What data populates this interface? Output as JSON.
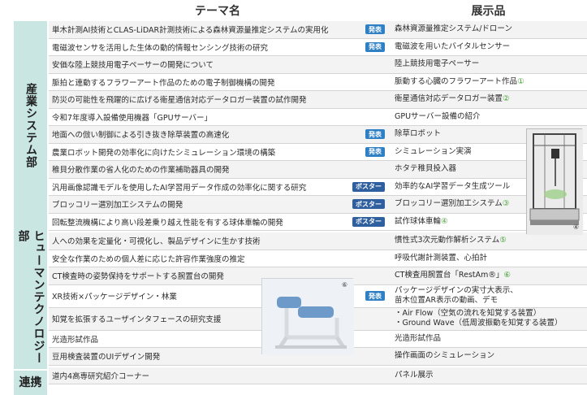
{
  "header": {
    "theme": "テーマ名",
    "exhibit": "展示品"
  },
  "departments": [
    {
      "label": "産業システム部"
    },
    {
      "label": "ヒューマンテクノロジー部"
    },
    {
      "label": "連携"
    }
  ],
  "badges": {
    "present": "発表",
    "poster": "ポスター"
  },
  "rows": [
    {
      "theme": "単木計測AI技術とCLAS-LiDAR計測技術による森林資源量推定システムの実用化",
      "badge": "発表",
      "exhibit": "森林資源量推定システム/ドローン"
    },
    {
      "theme": "電磁波センサを活用した生体の動的情報センシング技術の研究",
      "badge": "発表",
      "exhibit": "電磁波を用いたバイタルセンサー"
    },
    {
      "theme": "安価な陸上競技用電子ペーサーの開発について",
      "exhibit": "陸上競技用電子ペーサー"
    },
    {
      "theme": "脈拍と連動するフラワーアート作品のための電子制御機構の開発",
      "exhibit": "脈動する心臓のフラワーアート作品",
      "exhibit_num": "①"
    },
    {
      "theme": "防災の可能性を飛躍的に広げる衛星通信対応データロガー装置の試作開発",
      "exhibit": "衛星通信対応データロガー装置",
      "exhibit_num": "②"
    },
    {
      "theme": "令和7年度導入設備使用機器「GPUサーバー」",
      "exhibit": "GPUサーバー設備の紹介"
    },
    {
      "theme": "地面への倣い制御による引き抜き除草装置の高速化",
      "badge": "発表",
      "exhibit": "除草ロボット"
    },
    {
      "theme": "農業ロボット開発の効率化に向けたシミュレーション環境の構築",
      "badge": "発表",
      "exhibit": "シミュレーション実演"
    },
    {
      "theme": "稚貝分散作業の省人化のための作業補助器具の開発",
      "exhibit": "ホタテ稚貝投入器"
    },
    {
      "theme": "汎用画像認識モデルを使用したAI学習用データ作成の効率化に関する研究",
      "badge": "ポスター",
      "exhibit": "効率的なAI学習データ生成ツール"
    },
    {
      "theme": "ブロッコリー選別加工システムの開発",
      "badge": "ポスター",
      "exhibit": "ブロッコリー選別加工システム",
      "exhibit_num": "③"
    },
    {
      "theme": "回転整流機構により高い段差乗り越え性能を有する球体車輪の開発",
      "badge": "ポスター",
      "exhibit": "試作球体車輪",
      "exhibit_num": "④"
    },
    {
      "theme": "人への効果を定量化・可視化し、製品デザインに生かす技術",
      "exhibit": "慣性式3次元動作解析システム",
      "exhibit_num": "⑤"
    },
    {
      "theme": "安全な作業のための個人差に応じた許容作業強度の推定",
      "exhibit": "呼吸代謝計測装置、心拍計"
    },
    {
      "theme": "CT検査時の姿勢保持をサポートする腕置台の開発",
      "exhibit": "CT検査用腕置台「RestAm®」",
      "exhibit_num": "⑥"
    },
    {
      "theme": "XR技術×パッケージデザイン・林業",
      "badge": "発表",
      "exhibit": "パッケージデザインの実寸大表示、",
      "exhibit2": "苗木位置AR表示の動画、デモ"
    },
    {
      "theme": "知覚を拡張するユーザインタフェースの研究支援",
      "exhibit": "・Air Flow（空気の流れを知覚する装置）",
      "exhibit2": "・Ground Wave（低周波振動を知覚する装置）"
    },
    {
      "theme": "光造形試作品",
      "exhibit": "光造形試作品"
    },
    {
      "theme": "豆用検査装置のUIデザイン開発",
      "exhibit": "操作画面のシミュレーション"
    },
    {
      "theme": "道内4高専研究紹介コーナー",
      "exhibit": "パネル展示"
    }
  ],
  "photos": {
    "frame_num": "④",
    "chair_num": "⑥"
  }
}
